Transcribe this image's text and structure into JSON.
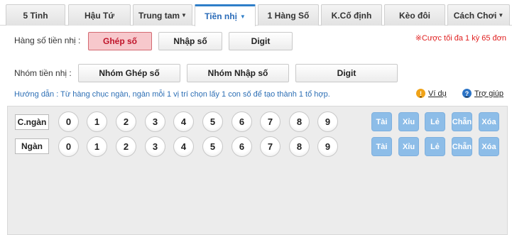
{
  "tabs": [
    {
      "label": "5 Tinh",
      "caret": false
    },
    {
      "label": "Hậu Tứ",
      "caret": false
    },
    {
      "label": "Trung tam",
      "caret": true
    },
    {
      "label": "Tiền nhị",
      "caret": true,
      "active": true
    },
    {
      "label": "1 Hàng Số",
      "caret": false
    },
    {
      "label": "K.Cố định",
      "caret": false
    },
    {
      "label": "Kèo đôi",
      "caret": false
    },
    {
      "label": "Cách Chơi",
      "caret": true
    }
  ],
  "row1": {
    "label": "Hàng số tiền nhị :",
    "buttons": [
      "Ghép số",
      "Nhập số",
      "Digit"
    ],
    "selected": 0
  },
  "max_note": "※Cược tối đa 1 kỳ 65 đơn",
  "row2": {
    "label": "Nhóm tiền nhị :",
    "buttons": [
      "Nhóm Ghép số",
      "Nhóm Nhập số",
      "Digit"
    ]
  },
  "guide": "Hướng dẫn : Từ hàng chục ngàn, ngàn mỗi 1 vị trí chọn lấy 1 con số để tạo thành 1 tổ hợp.",
  "links": {
    "example": "Ví dụ",
    "help": "Trợ giúp",
    "example_icon": "!",
    "help_icon": "?"
  },
  "grid": {
    "rows": [
      {
        "label": "C.ngàn"
      },
      {
        "label": "Ngàn"
      }
    ],
    "digits": [
      "0",
      "1",
      "2",
      "3",
      "4",
      "5",
      "6",
      "7",
      "8",
      "9"
    ],
    "quick": [
      "Tài",
      "Xỉu",
      "Lẻ",
      "Chẵn",
      "Xóa"
    ]
  },
  "colors": {
    "accent": "#2f7fc9",
    "selected_bg": "#f7c8cc",
    "selected_text": "#c0142a",
    "quick_bg": "#8dbde8",
    "note": "#e02020"
  }
}
